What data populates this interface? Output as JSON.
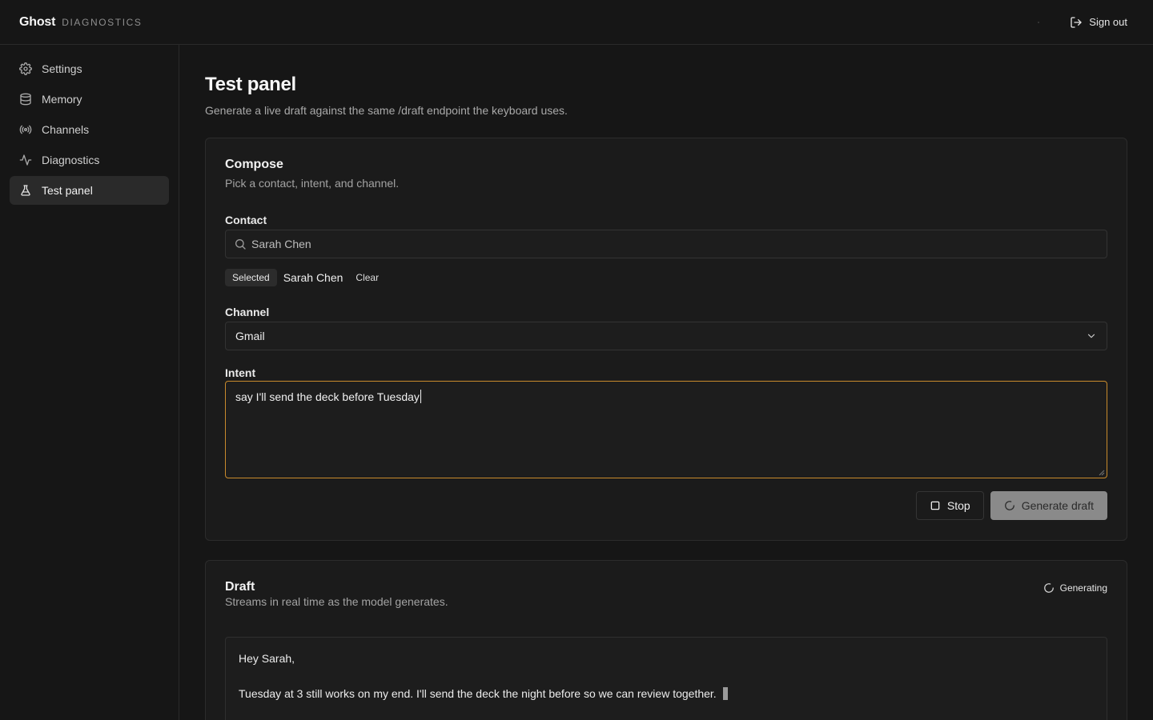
{
  "header": {
    "brand": "Ghost",
    "brand_sub": "DIAGNOSTICS",
    "sign_out_label": "Sign out",
    "sign_out_icon": "log-out-icon"
  },
  "sidebar": {
    "items": [
      {
        "label": "Settings",
        "icon": "gear-icon",
        "active": false
      },
      {
        "label": "Memory",
        "icon": "database-icon",
        "active": false
      },
      {
        "label": "Channels",
        "icon": "broadcast-icon",
        "active": false
      },
      {
        "label": "Diagnostics",
        "icon": "activity-icon",
        "active": false
      },
      {
        "label": "Test panel",
        "icon": "flask-icon",
        "active": true
      }
    ]
  },
  "page": {
    "title": "Test panel",
    "subtitle": "Generate a live draft against the same /draft endpoint the keyboard uses."
  },
  "compose": {
    "title": "Compose",
    "subtitle": "Pick a contact, intent, and channel.",
    "contact_label": "Contact",
    "contact_value": "Sarah Chen",
    "selected_pill": "Selected",
    "selected_name": "Sarah Chen",
    "clear_label": "Clear",
    "channel_label": "Channel",
    "channel_value": "Gmail",
    "intent_label": "Intent",
    "intent_value": "say I'll send the deck before Tuesday",
    "stop_label": "Stop",
    "generate_label": "Generate draft"
  },
  "draft": {
    "title": "Draft",
    "subtitle": "Streams in real time as the model generates.",
    "status": "Generating",
    "greeting": "Hey Sarah,",
    "body": "Tuesday at 3 still works on my end. I'll send the deck the night before so we can review together."
  },
  "colors": {
    "background": "#161616",
    "accent_focus": "#c98b2c",
    "active_nav": "#2a2a2a"
  }
}
